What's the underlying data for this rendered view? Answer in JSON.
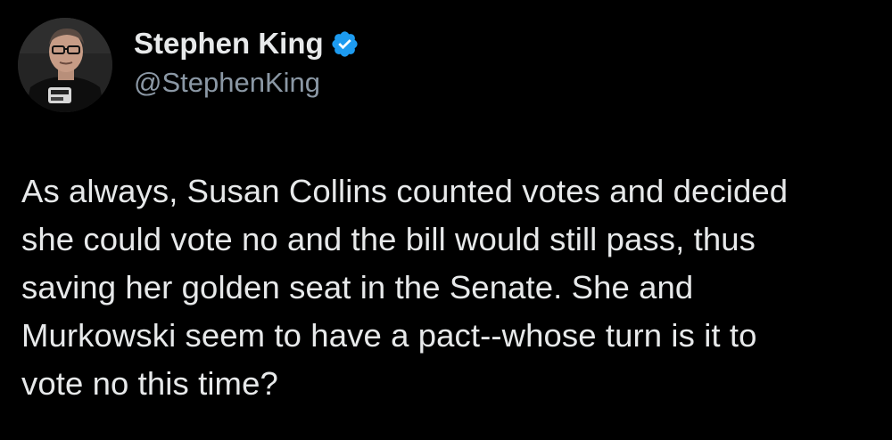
{
  "tweet": {
    "author": {
      "display_name": "Stephen King",
      "handle": "@StephenKing",
      "verified": true
    },
    "body_lines": [
      "As always, Susan Collins counted votes and decided",
      "she could vote no and the bill would still pass, thus",
      "saving her golden seat in the Senate. She and",
      "Murkowski seem to have a pact--whose turn is it to",
      "vote no this time?"
    ]
  },
  "colors": {
    "background": "#000000",
    "text_primary": "#e7e9ea",
    "text_secondary": "#8b98a5",
    "verified_blue": "#1d9bf0"
  },
  "icons": {
    "verified": "verified-badge-icon"
  }
}
